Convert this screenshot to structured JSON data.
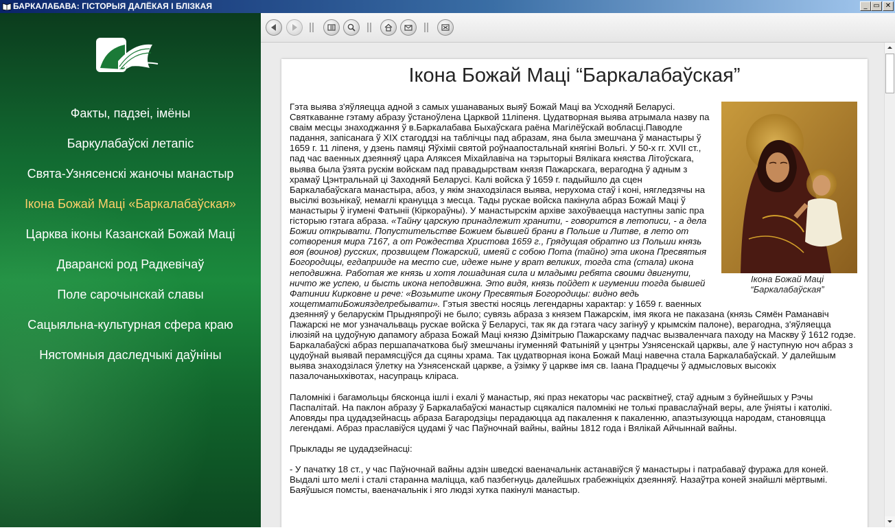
{
  "window": {
    "title": "БАРКАЛАБАВА: ГІСТОРЫЯ ДАЛЁКАЯ І БЛІЗКАЯ",
    "controls": [
      "_",
      "▭",
      "✕"
    ]
  },
  "sidebar": {
    "logo_icon": "open-book-logo-icon",
    "items": [
      {
        "label": "Факты, падзеі, імёны"
      },
      {
        "label": "Баркулабаўскі летапіс"
      },
      {
        "label": "Свята-Узнясенскі жаночы манастыр"
      },
      {
        "label": "Ікона Божай Маці «Баркалабаўская»"
      },
      {
        "label": "Царква іконы Казанскай Божай Маці"
      },
      {
        "label": "Дваранскі род Радкевічаў"
      },
      {
        "label": "Поле сарочынскай славы"
      },
      {
        "label": "Сацыяльна-культурная сфера краю"
      },
      {
        "label": "Нястомныя даследчыкі даўніны"
      }
    ],
    "active_index": 3,
    "active_color": "#ffcf6a"
  },
  "toolbar": {
    "buttons": [
      "back-icon",
      "forward-icon",
      "contents-icon",
      "search-icon",
      "home-icon",
      "mail-icon",
      "exit-icon"
    ]
  },
  "article": {
    "title": "Ікона Божай Маці “Баркалабаўская”",
    "caption": "Ікона Божай Маці “Баркалабаўская”",
    "p1_a": "Гэта выява з'яўляецца адной з самых ушанаваных выяў Божай Маці ва Усходняй Беларусі. Святкаванне гэтаму абразу ўстаноўлена Царквой 11ліпеня. Цудатворная выява атрымала назву па сваім месцы знаходжання ў в.Баркалабава Быхаўскага раёна Магілёўскай вобласці.Паводле падання, запісанага ў XIX стагоддзі на таблічцы пад абразам, яна была змешчана ў манастыры ў 1659 г. 11 ліпеня, у дзень памяці Яўхіміі святой роўнаапостальнай княгіні Вольгі. У 50-х гг. XVII ст., пад час ваенных дзеянняў цара Аляксея Міхайлавіча на тэрыторыі Вялікага княства Літоўскага, выява была ўзята рускім войскам пад правадырствам князя Пажарскага, верагодна ў адным з храмаў Цэнтральнай ці Заходняй Беларусі. Калі войска ў 1659 г. падыйшло да сцен Баркалабаўскага манастыра, абоз, у якім знаходзілася выява, нерухома стаў і коні, нягледзячы на высілкі возьнікаў, немаглі крануцца з месца. Тады рускае войска пакінула абраз Божай Маці ў манастыры ў ігумені Фатыніі (Кіркораўны). У манастырскім архіве захоўваецца наступны запіс пра гісторыю гэтага абраза. ",
    "p1_quote": "«Тайну царскую принадлежит хранити, - говорится в летописи, - а дела Божии открывати. Попустительстве Божием бывшей брани в Польше и Литве, в лето от сотворения мира 7167, а от Рождества Христова 1659 г., Грядущая обратно из Польши князь воя (воинов) русских, прозвищем Пожарский, имеяй с собою Пота (тайно) эта икона Пресвятыя Богородицы, егдаприиде на место сие, идеже ныне у врат великих, тогда ста (стала) икона неподвижна. Работая же князь и хотя лошадиная сила и младыми ребята своими двигнути, ничто же успею, и бысть икона неподвижна. Это видя, князь пойдет к игумении тогда бывшей Фатинии Кирковне и рече: «Возьмите икону Пресвятыя Богородицы: видно ведь хощетматиБожиязделребывати».",
    "p1_b": " Гэтыя звесткі носяць легендарны характар: у 1659 г. ваенных дзеянняў у беларускім Прыдняпроўі не было; сувязь абраза з князем Пажарскім, імя якога не паказана (князь Сямён Раманавіч Пажарскі не мог узначальваць рускае войска ў Беларусі, так як да гэтага часу загінуў у крымскім палоне), верагодна, з'яўляецца ілюзіяй на цудоўную дапамогу абраза Божай Маці князю Дзімітрыю Пажарскаму падчас вызваленчага паходу на Маскву ў 1612 годзе. Баркалабаўскі абраз першапачаткова быў змешчаны ігуменняй Фатыніяй у цэнтры Узнясенскай царквы, але ў наступную ноч абраз з цудоўнай выявай перамясціўся да сцяны храма. Так цудатворная ікона Божай Маці навечна стала Баркалабаўскай. У далейшым выява знаходзілася ўлетку на Узнясенскай царкве, а ўзімку ў царкве імя св. Іаана Прадцечы ў адмысловых высокіх пазалочаныхківотах, насупраць кліраса.",
    "p2": "Паломнікі і багамольцы бясконца ішлі і ехалі ў манастыр, які праз некаторы час расквітнеў, стаў адным з буйнейшых у Рэчы Паспалітай. На паклон абразу ў Баркалабаўскі манастыр сцякаліся паломнікі не толькі праваслаўнай веры, але ўніяты і католікі. Аповяды пра цудадзейнасць абраза Багародзіцы перадаюцца ад пакалення к пакаленню, апаэтызуюцца народам, становяцца легендамі. Абраз праславіўся цудамі ў час Паўночнай вайны, вайны 1812 года і Вялікай Айчыннай вайны.",
    "p3": "Прыклады яе цудадзейнасці:",
    "p4": "- У пачатку 18 ст., у час Паўночнай вайны адзін шведскі ваеначальнік астанавіўся ў манастыры і патрабаваў фуража для коней. Выдалі што мелі і сталі старанна маліцца, каб пазбегнуць далейшых грабежніцкіх дзеянняў. Назаўтра коней знайшлі мёртвымі. Баяўшыся помсты, ваеначальнік і яго людзі хутка пакінулі манастыр."
  }
}
